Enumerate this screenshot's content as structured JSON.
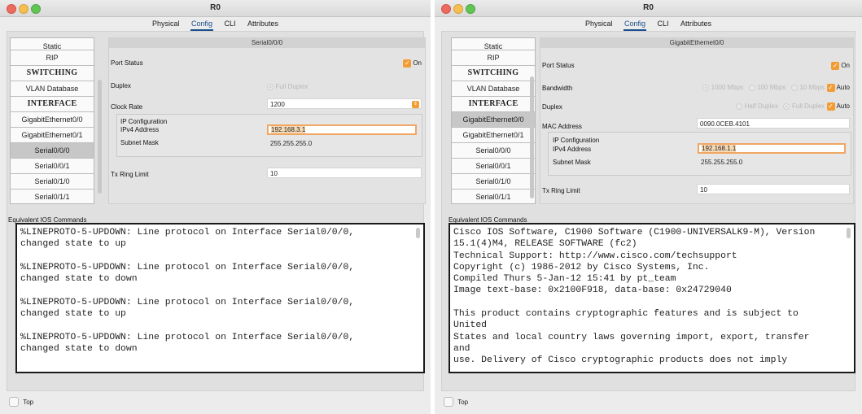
{
  "left": {
    "title": "R0",
    "tabs": [
      "Physical",
      "Config",
      "CLI",
      "Attributes"
    ],
    "sidebar": [
      "Static",
      "RIP",
      "SWITCHING",
      "VLAN Database",
      "INTERFACE",
      "GigabitEthernet0/0",
      "GigabitEthernet0/1",
      "Serial0/0/0",
      "Serial0/0/1",
      "Serial0/1/0",
      "Serial0/1/1"
    ],
    "interface_title": "Serial0/0/0",
    "port_status_label": "Port Status",
    "port_status_value": "On",
    "duplex_label": "Duplex",
    "duplex_value": "Full Duplex",
    "clock_rate_label": "Clock Rate",
    "clock_rate_value": "1200",
    "ip_config_label": "IP Configuration",
    "ipv4_label": "IPv4 Address",
    "ipv4_value": "192.168.3.1",
    "subnet_label": "Subnet Mask",
    "subnet_value": "255.255.255.0",
    "tx_label": "Tx Ring Limit",
    "tx_value": "10",
    "equiv_label": "Equivalent IOS Commands",
    "console_text": "%LINEPROTO-5-UPDOWN: Line protocol on Interface Serial0/0/0,\nchanged state to up\n\n%LINEPROTO-5-UPDOWN: Line protocol on Interface Serial0/0/0,\nchanged state to down\n\n%LINEPROTO-5-UPDOWN: Line protocol on Interface Serial0/0/0,\nchanged state to up\n\n%LINEPROTO-5-UPDOWN: Line protocol on Interface Serial0/0/0,\nchanged state to down",
    "top_label": "Top"
  },
  "right": {
    "title": "R0",
    "tabs": [
      "Physical",
      "Config",
      "CLI",
      "Attributes"
    ],
    "sidebar": [
      "Static",
      "RIP",
      "SWITCHING",
      "VLAN Database",
      "INTERFACE",
      "GigabitEthernet0/0",
      "GigabitEthernet0/1",
      "Serial0/0/0",
      "Serial0/0/1",
      "Serial0/1/0",
      "Serial0/1/1"
    ],
    "interface_title": "GigabitEthernet0/0",
    "port_status_label": "Port Status",
    "port_status_value": "On",
    "bandwidth_label": "Bandwidth",
    "bandwidth_options": [
      "1000 Mbps",
      "100 Mbps",
      "10 Mbps"
    ],
    "auto_label": "Auto",
    "duplex_label": "Duplex",
    "duplex_options": [
      "Half Duplex",
      "Full Duplex"
    ],
    "mac_label": "MAC Address",
    "mac_value": "0090.0CEB.4101",
    "ip_config_label": "IP Configuration",
    "ipv4_label": "IPv4 Address",
    "ipv4_value": "192.168.1.1",
    "subnet_label": "Subnet Mask",
    "subnet_value": "255.255.255.0",
    "tx_label": "Tx Ring Limit",
    "tx_value": "10",
    "equiv_label": "Equivalent IOS Commands",
    "console_text": "Cisco IOS Software, C1900 Software (C1900-UNIVERSALK9-M), Version\n15.1(4)M4, RELEASE SOFTWARE (fc2)\nTechnical Support: http://www.cisco.com/techsupport\nCopyright (c) 1986-2012 by Cisco Systems, Inc.\nCompiled Thurs 5-Jan-12 15:41 by pt_team\nImage text-base: 0x2100F918, data-base: 0x24729040\n\nThis product contains cryptographic features and is subject to\nUnited\nStates and local country laws governing import, export, transfer\nand\nuse. Delivery of Cisco cryptographic products does not imply",
    "top_label": "Top"
  },
  "colors": {
    "accent": "#f39c33",
    "tab_underline": "#1b4f8f",
    "focus_border": "#f0a764"
  }
}
